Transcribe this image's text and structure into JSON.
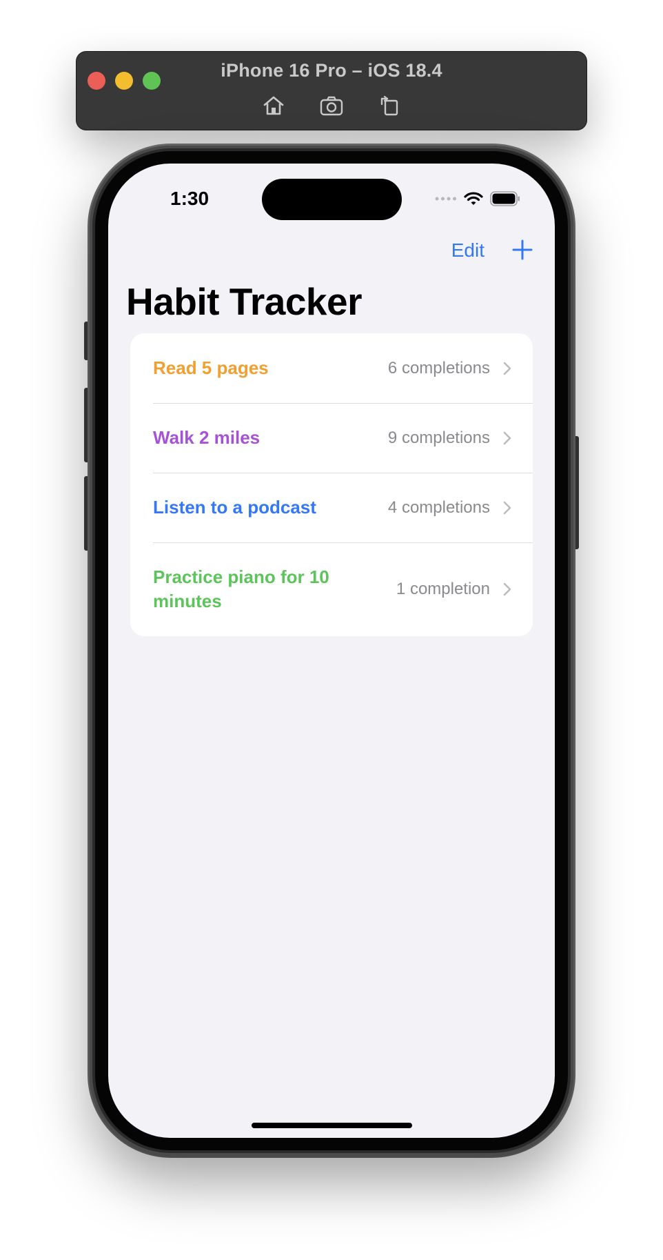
{
  "simulator": {
    "title": "iPhone 16 Pro – iOS 18.4",
    "tools": [
      "home-icon",
      "screenshot-icon",
      "rotate-icon"
    ]
  },
  "status_bar": {
    "time": "1:30",
    "icons": [
      "cellular-dots-icon",
      "wifi-icon",
      "battery-icon"
    ]
  },
  "nav": {
    "edit_label": "Edit",
    "add_icon": "plus-icon",
    "title": "Habit Tracker"
  },
  "habits": [
    {
      "name": "Read 5 pages",
      "count": "6 completions",
      "color": "#f0a030"
    },
    {
      "name": "Walk 2 miles",
      "count": "9 completions",
      "color": "#a552d6"
    },
    {
      "name": "Listen to a podcast",
      "count": "4 completions",
      "color": "#3478f6"
    },
    {
      "name": "Practice piano for 10 minutes",
      "count": "1 completion",
      "color": "#5cc45a"
    }
  ],
  "colors": {
    "accent": "#3478f6",
    "background": "#f2f2f7"
  }
}
